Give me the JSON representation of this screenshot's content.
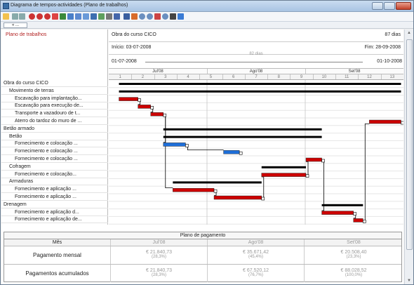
{
  "window": {
    "title": "Diagrama de tempos-actividades (Plano de trabalhos)"
  },
  "tabrow": {
    "nav_label": "« ..."
  },
  "header": {
    "section_label": "Plano de trabalhos",
    "project_name": "Obra do curso CICO",
    "duration": "87 dias",
    "start": "Início: 03-07-2008",
    "end": "Fim: 28-09-2008",
    "timeline_duration": "82 dias",
    "timeline_start": "01-07-2008",
    "timeline_end": "01-10-2008",
    "months": [
      "Jul'08",
      "Ago'08",
      "Set'08"
    ],
    "weeks": [
      "1",
      "2",
      "3",
      "4",
      "5",
      "6",
      "7",
      "8",
      "9",
      "10",
      "11",
      "12",
      "13"
    ]
  },
  "tasks": [
    {
      "label": "Obra do curso CICO",
      "indent": 0
    },
    {
      "label": "Movimento de terras",
      "indent": 1
    },
    {
      "label": "Escavação para implantação...",
      "indent": 2
    },
    {
      "label": "Escavação para execução de...",
      "indent": 2
    },
    {
      "label": "Transporte a vazadouro de t...",
      "indent": 2
    },
    {
      "label": "Aterro do tardoz do muro de ...",
      "indent": 2
    },
    {
      "label": "Betão armado",
      "indent": 0
    },
    {
      "label": "Betão",
      "indent": 1
    },
    {
      "label": "Fornecimento e colocação ...",
      "indent": 2
    },
    {
      "label": "Fornecimento e colocação ...",
      "indent": 2
    },
    {
      "label": "Fornecimento e colocação ...",
      "indent": 2
    },
    {
      "label": "Cofragem",
      "indent": 1
    },
    {
      "label": "Fornecimento e colocação...",
      "indent": 2
    },
    {
      "label": "Armaduras",
      "indent": 1
    },
    {
      "label": "Fornecimento e aplicação ...",
      "indent": 2
    },
    {
      "label": "Fornecimento e aplicação ...",
      "indent": 2
    },
    {
      "label": "Drenagem",
      "indent": 0
    },
    {
      "label": "Fornecimento e aplicação d...",
      "indent": 2
    },
    {
      "label": "Fornecimento e aplicação de...",
      "indent": 2
    }
  ],
  "payment": {
    "title": "Plano de pagamento",
    "col_header": "Mês",
    "months": [
      "Jul'08",
      "Ago'08",
      "Set'08"
    ],
    "rows": [
      {
        "label": "Pagamento mensal",
        "values": [
          "€ 21.840,73",
          "€ 35.671,42",
          "€ 20.508,40"
        ],
        "pcts": [
          "(28,3%)",
          "(45,4%)",
          "(23,3%)"
        ]
      },
      {
        "label": "Pagamentos acumulados",
        "values": [
          "€ 21.840,73",
          "€ 67.520,12",
          "€ 88.028,52"
        ],
        "pcts": [
          "(28,3%)",
          "(76,7%)",
          "(100,0%)"
        ]
      }
    ]
  },
  "colors": {
    "summary": "#000000",
    "critical": "#cc0000",
    "normal": "#1e6fd9"
  },
  "icons": [
    "undo-icon",
    "redo-icon",
    "print-icon",
    "zoom-in-icon",
    "zoom-out-icon",
    "chart-icon",
    "link-icon"
  ],
  "gantt_bars": [
    {
      "row": 0,
      "start": 3,
      "end": 92,
      "kind": "summary"
    },
    {
      "row": 1,
      "start": 3,
      "end": 92,
      "kind": "summary"
    },
    {
      "row": 2,
      "start": 3,
      "end": 9,
      "kind": "critical"
    },
    {
      "row": 3,
      "start": 9,
      "end": 13,
      "kind": "critical"
    },
    {
      "row": 4,
      "start": 13,
      "end": 17,
      "kind": "critical"
    },
    {
      "row": 5,
      "start": 82,
      "end": 92,
      "kind": "critical"
    },
    {
      "row": 6,
      "start": 17,
      "end": 67,
      "kind": "summary"
    },
    {
      "row": 7,
      "start": 17,
      "end": 67,
      "kind": "summary"
    },
    {
      "row": 8,
      "start": 17,
      "end": 24,
      "kind": "normal"
    },
    {
      "row": 9,
      "start": 36,
      "end": 41,
      "kind": "normal"
    },
    {
      "row": 10,
      "start": 62,
      "end": 67,
      "kind": "critical"
    },
    {
      "row": 11,
      "start": 48,
      "end": 62,
      "kind": "summary"
    },
    {
      "row": 12,
      "start": 48,
      "end": 62,
      "kind": "critical"
    },
    {
      "row": 13,
      "start": 20,
      "end": 48,
      "kind": "summary"
    },
    {
      "row": 14,
      "start": 20,
      "end": 33,
      "kind": "critical"
    },
    {
      "row": 15,
      "start": 33,
      "end": 48,
      "kind": "critical"
    },
    {
      "row": 16,
      "start": 67,
      "end": 80,
      "kind": "summary"
    },
    {
      "row": 17,
      "start": 67,
      "end": 77,
      "kind": "critical"
    },
    {
      "row": 18,
      "start": 77,
      "end": 80,
      "kind": "critical"
    }
  ],
  "gantt_links": [
    {
      "from": 2,
      "to": 3
    },
    {
      "from": 3,
      "to": 4
    },
    {
      "from": 4,
      "to": 8
    },
    {
      "from": 4,
      "to": 14
    },
    {
      "from": 8,
      "to": 9
    },
    {
      "from": 14,
      "to": 15
    },
    {
      "from": 15,
      "to": 12
    },
    {
      "from": 12,
      "to": 10
    },
    {
      "from": 10,
      "to": 17
    },
    {
      "from": 17,
      "to": 18
    },
    {
      "from": 18,
      "to": 5
    }
  ]
}
